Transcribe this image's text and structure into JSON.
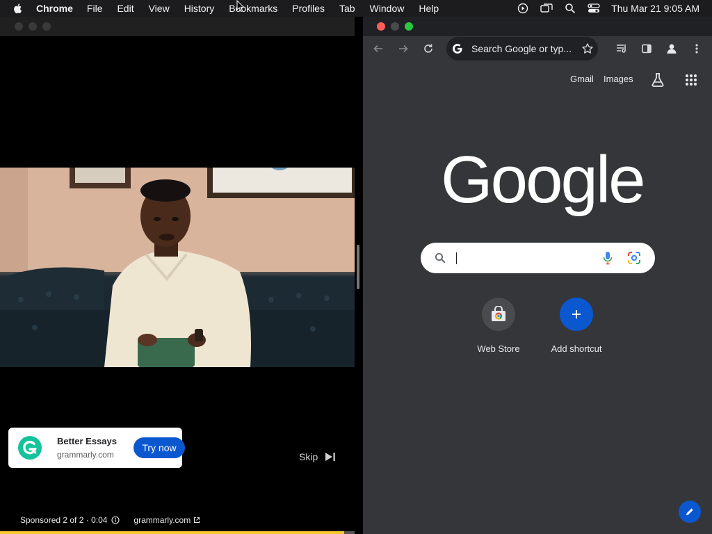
{
  "menubar": {
    "app_name": "Chrome",
    "menus": [
      "File",
      "Edit",
      "View",
      "History",
      "Bookmarks",
      "Profiles",
      "Tab",
      "Window",
      "Help"
    ],
    "clock": "Thu Mar 21  9:05 AM",
    "status_icons": [
      "screen-record-icon",
      "screen-mirroring-icon",
      "spotlight-search-icon",
      "control-center-icon"
    ]
  },
  "video_ad": {
    "advertiser_title": "Better Essays",
    "advertiser_domain": "grammarly.com",
    "cta_label": "Try now",
    "skip_label": "Skip",
    "sponsored_text": "Sponsored 2 of 2 · 0:04",
    "sponsor_link": "grammarly.com",
    "progress": 0.97,
    "progress_color": "#f6c62e"
  },
  "chrome": {
    "omnibox_placeholder": "Search Google or typ...",
    "links": [
      "Gmail",
      "Images"
    ],
    "logo_text": "Google",
    "shortcuts": [
      {
        "label": "Web Store",
        "icon": "chrome-web-store-icon"
      },
      {
        "label": "Add shortcut",
        "icon": "plus-icon"
      }
    ],
    "accent_color": "#0b57d0"
  }
}
